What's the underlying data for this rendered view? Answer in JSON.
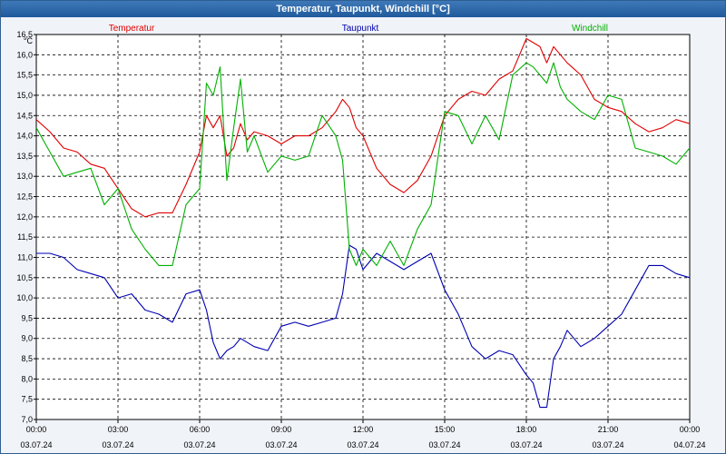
{
  "window": {
    "title": "Temperatur, Taupunkt, Windchill [°C]"
  },
  "chart_data": {
    "type": "line",
    "title": "Temperatur, Taupunkt, Windchill [°C]",
    "ylabel": "°C",
    "ylim": [
      7.0,
      16.5
    ],
    "yticks": [
      "16,5",
      "16,0",
      "15,5",
      "15,0",
      "14,5",
      "14,0",
      "13,5",
      "13,0",
      "12,5",
      "12,0",
      "11,5",
      "11,0",
      "10,5",
      "10,0",
      "9,5",
      "9,0",
      "8,5",
      "8,0",
      "7,5",
      "7,0"
    ],
    "xlim": [
      0,
      24
    ],
    "xticks": [
      {
        "time": "00:00",
        "date": "03.07.24",
        "x": 0
      },
      {
        "time": "03:00",
        "date": "03.07.24",
        "x": 3
      },
      {
        "time": "06:00",
        "date": "03.07.24",
        "x": 6
      },
      {
        "time": "09:00",
        "date": "03.07.24",
        "x": 9
      },
      {
        "time": "12:00",
        "date": "03.07.24",
        "x": 12
      },
      {
        "time": "15:00",
        "date": "03.07.24",
        "x": 15
      },
      {
        "time": "18:00",
        "date": "03.07.24",
        "x": 18
      },
      {
        "time": "21:00",
        "date": "03.07.24",
        "x": 21
      },
      {
        "time": "00:00",
        "date": "04.07.24",
        "x": 24
      }
    ],
    "grid": true,
    "legend_position": "top",
    "series": [
      {
        "name": "Temperatur",
        "color": "#e00000",
        "x": [
          0,
          0.5,
          1,
          1.5,
          2,
          2.5,
          3,
          3.5,
          4,
          4.5,
          5,
          5.5,
          6,
          6.25,
          6.5,
          6.75,
          7,
          7.25,
          7.5,
          7.75,
          8,
          8.5,
          9,
          9.5,
          10,
          10.5,
          11,
          11.25,
          11.5,
          11.75,
          12,
          12.5,
          13,
          13.5,
          14,
          14.5,
          15,
          15.5,
          16,
          16.5,
          17,
          17.5,
          18,
          18.25,
          18.5,
          18.75,
          19,
          19.25,
          19.5,
          20,
          20.5,
          21,
          21.5,
          22,
          22.5,
          23,
          23.5,
          24
        ],
        "y": [
          14.4,
          14.1,
          13.7,
          13.6,
          13.3,
          13.2,
          12.7,
          12.2,
          12.0,
          12.1,
          12.1,
          12.8,
          13.6,
          14.5,
          14.2,
          14.5,
          13.5,
          13.7,
          14.3,
          13.9,
          14.1,
          14.0,
          13.8,
          14.0,
          14.0,
          14.2,
          14.6,
          14.9,
          14.7,
          14.2,
          14.0,
          13.2,
          12.8,
          12.6,
          12.9,
          13.5,
          14.5,
          14.9,
          15.1,
          15.0,
          15.4,
          15.6,
          16.4,
          16.3,
          16.2,
          15.8,
          16.2,
          16.0,
          15.8,
          15.5,
          14.9,
          14.7,
          14.6,
          14.3,
          14.1,
          14.2,
          14.4,
          14.3
        ]
      },
      {
        "name": "Taupunkt",
        "color": "#0000b0",
        "x": [
          0,
          0.5,
          1,
          1.5,
          2,
          2.5,
          3,
          3.5,
          4,
          4.5,
          5,
          5.5,
          6,
          6.25,
          6.5,
          6.75,
          7,
          7.25,
          7.5,
          7.75,
          8,
          8.5,
          9,
          9.5,
          10,
          10.5,
          11,
          11.25,
          11.5,
          11.75,
          12,
          12.5,
          13,
          13.5,
          14,
          14.5,
          15,
          15.5,
          16,
          16.5,
          17,
          17.5,
          18,
          18.25,
          18.5,
          18.75,
          19,
          19.25,
          19.5,
          20,
          20.5,
          21,
          21.5,
          22,
          22.5,
          23,
          23.5,
          24
        ],
        "y": [
          11.1,
          11.1,
          11.0,
          10.7,
          10.6,
          10.5,
          10.0,
          10.1,
          9.7,
          9.6,
          9.4,
          10.1,
          10.2,
          9.7,
          8.9,
          8.5,
          8.7,
          8.8,
          9.0,
          8.9,
          8.8,
          8.7,
          9.3,
          9.4,
          9.3,
          9.4,
          9.5,
          10.1,
          11.3,
          11.2,
          10.7,
          11.1,
          10.9,
          10.7,
          10.9,
          11.1,
          10.2,
          9.6,
          8.8,
          8.5,
          8.7,
          8.6,
          8.1,
          7.9,
          7.3,
          7.3,
          8.5,
          8.8,
          9.2,
          8.8,
          9.0,
          9.3,
          9.6,
          10.2,
          10.8,
          10.8,
          10.6,
          10.5
        ]
      },
      {
        "name": "Windchill",
        "color": "#00b000",
        "x": [
          0,
          0.5,
          1,
          1.5,
          2,
          2.5,
          3,
          3.5,
          4,
          4.5,
          5,
          5.5,
          6,
          6.25,
          6.5,
          6.75,
          7,
          7.25,
          7.5,
          7.75,
          8,
          8.5,
          9,
          9.5,
          10,
          10.5,
          11,
          11.25,
          11.5,
          11.75,
          12,
          12.5,
          13,
          13.5,
          14,
          14.5,
          15,
          15.5,
          16,
          16.5,
          17,
          17.5,
          18,
          18.25,
          18.5,
          18.75,
          19,
          19.25,
          19.5,
          20,
          20.5,
          21,
          21.5,
          22,
          22.5,
          23,
          23.5,
          24
        ],
        "y": [
          14.2,
          13.6,
          13.0,
          13.1,
          13.2,
          12.3,
          12.7,
          11.7,
          11.2,
          10.8,
          10.8,
          12.3,
          12.7,
          15.3,
          15.0,
          15.7,
          12.9,
          14.2,
          15.4,
          13.6,
          14.0,
          13.1,
          13.5,
          13.4,
          13.5,
          14.5,
          14.0,
          13.4,
          11.2,
          10.8,
          11.2,
          10.8,
          11.4,
          10.8,
          11.7,
          12.3,
          14.6,
          14.5,
          13.8,
          14.5,
          13.9,
          15.5,
          15.8,
          15.7,
          15.5,
          15.3,
          15.8,
          15.2,
          14.9,
          14.6,
          14.4,
          15.0,
          14.9,
          13.7,
          13.6,
          13.5,
          13.3,
          13.7
        ]
      }
    ]
  }
}
